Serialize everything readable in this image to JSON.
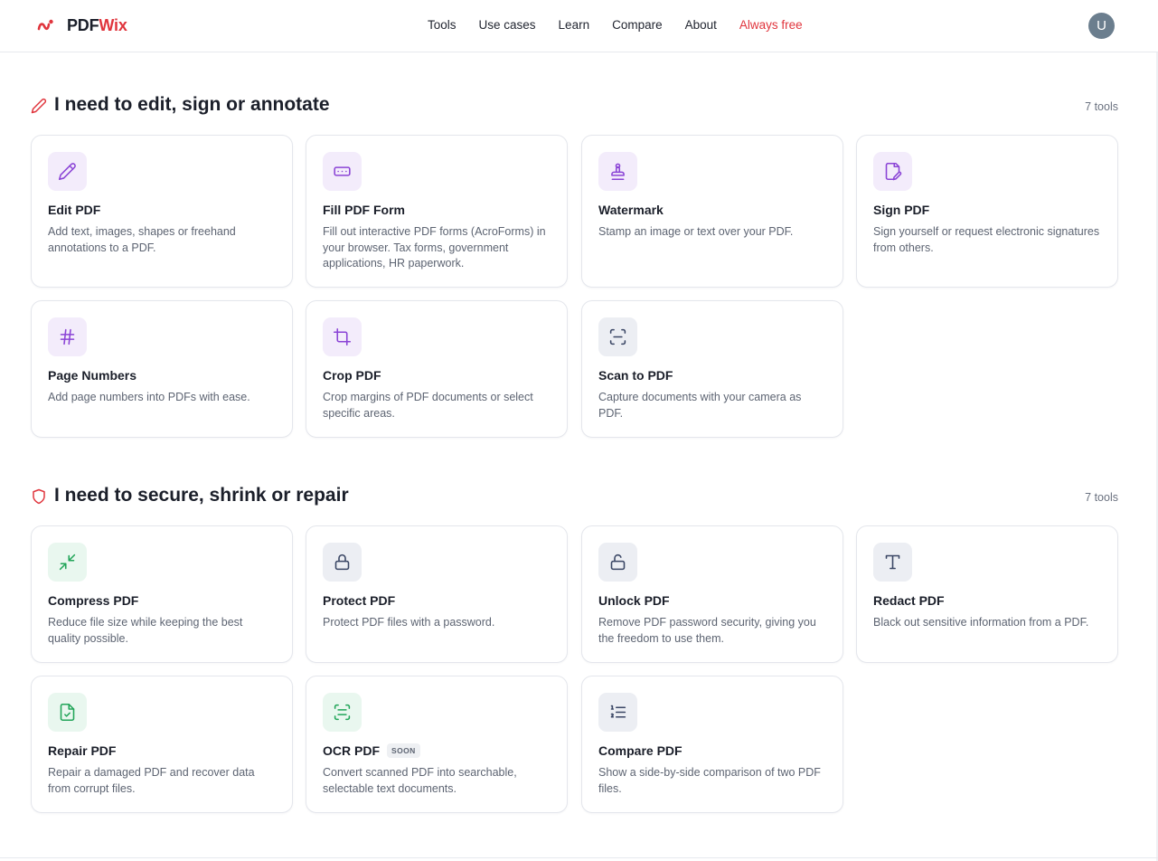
{
  "header": {
    "logo": {
      "part1": "PDF",
      "part2": "Wix"
    },
    "nav": [
      {
        "label": "Tools",
        "accent": false
      },
      {
        "label": "Use cases",
        "accent": false
      },
      {
        "label": "Learn",
        "accent": false
      },
      {
        "label": "Compare",
        "accent": false
      },
      {
        "label": "About",
        "accent": false
      },
      {
        "label": "Always free",
        "accent": true
      }
    ],
    "avatar_initial": "U"
  },
  "colors": {
    "brand_red": "#e0353d",
    "purple": "#8b44d6",
    "slate": "#3a4664",
    "green": "#22a559"
  },
  "sections": [
    {
      "icon": "pencil-icon",
      "title": "I need to edit, sign or annotate",
      "count": "7 tools",
      "cards": [
        {
          "name": "edit-pdf",
          "icon": "pencil-icon",
          "tone": "purple",
          "title": "Edit PDF",
          "desc": "Add text, images, shapes or freehand annotations to a PDF.",
          "badge": ""
        },
        {
          "name": "fill-pdf-form",
          "icon": "form-field-icon",
          "tone": "purple",
          "title": "Fill PDF Form",
          "desc": "Fill out interactive PDF forms (AcroForms) in your browser. Tax forms, government applications, HR paperwork.",
          "badge": ""
        },
        {
          "name": "watermark",
          "icon": "stamp-icon",
          "tone": "purple",
          "title": "Watermark",
          "desc": "Stamp an image or text over your PDF.",
          "badge": ""
        },
        {
          "name": "sign-pdf",
          "icon": "signature-icon",
          "tone": "purple",
          "title": "Sign PDF",
          "desc": "Sign yourself or request electronic signatures from others.",
          "badge": ""
        },
        {
          "name": "page-numbers",
          "icon": "hash-icon",
          "tone": "purple",
          "title": "Page Numbers",
          "desc": "Add page numbers into PDFs with ease.",
          "badge": ""
        },
        {
          "name": "crop-pdf",
          "icon": "crop-icon",
          "tone": "purple",
          "title": "Crop PDF",
          "desc": "Crop margins of PDF documents or select specific areas.",
          "badge": ""
        },
        {
          "name": "scan-to-pdf",
          "icon": "scan-icon",
          "tone": "slate",
          "title": "Scan to PDF",
          "desc": "Capture documents with your camera as PDF.",
          "badge": ""
        }
      ]
    },
    {
      "icon": "shield-icon",
      "title": "I need to secure, shrink or repair",
      "count": "7 tools",
      "cards": [
        {
          "name": "compress-pdf",
          "icon": "shrink-arrows-icon",
          "tone": "green",
          "title": "Compress PDF",
          "desc": "Reduce file size while keeping the best quality possible.",
          "badge": ""
        },
        {
          "name": "protect-pdf",
          "icon": "lock-icon",
          "tone": "slate",
          "title": "Protect PDF",
          "desc": "Protect PDF files with a password.",
          "badge": ""
        },
        {
          "name": "unlock-pdf",
          "icon": "unlock-icon",
          "tone": "slate",
          "title": "Unlock PDF",
          "desc": "Remove PDF password security, giving you the freedom to use them.",
          "badge": ""
        },
        {
          "name": "redact-pdf",
          "icon": "text-t-icon",
          "tone": "slate",
          "title": "Redact PDF",
          "desc": "Black out sensitive information from a PDF.",
          "badge": ""
        },
        {
          "name": "repair-pdf",
          "icon": "file-check-icon",
          "tone": "green",
          "title": "Repair PDF",
          "desc": "Repair a damaged PDF and recover data from corrupt files.",
          "badge": ""
        },
        {
          "name": "ocr-pdf",
          "icon": "scan-text-icon",
          "tone": "green",
          "title": "OCR PDF",
          "desc": "Convert scanned PDF into searchable, selectable text documents.",
          "badge": "SOON"
        },
        {
          "name": "compare-pdf",
          "icon": "list-ordered-icon",
          "tone": "slate",
          "title": "Compare PDF",
          "desc": "Show a side-by-side comparison of two PDF files.",
          "badge": ""
        }
      ]
    }
  ]
}
